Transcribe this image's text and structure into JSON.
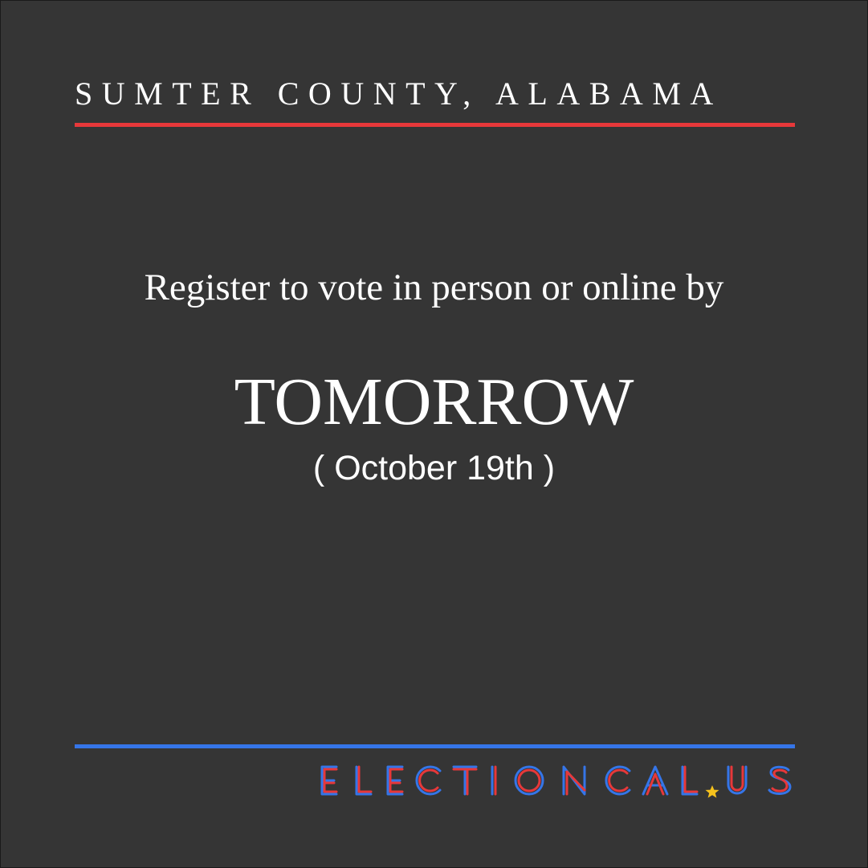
{
  "header": {
    "county": "SUMTER COUNTY, ALABAMA"
  },
  "main": {
    "register_text": "Register to vote in person or online by",
    "deadline": "TOMORROW",
    "date": "( October 19th )"
  },
  "logo": {
    "text": "ELECTIONCAL.US",
    "icon": "star-icon"
  },
  "colors": {
    "background": "#353535",
    "accent_red": "#e7383a",
    "accent_blue": "#3575e8",
    "star_yellow": "#f6c21c",
    "text": "#ffffff"
  }
}
